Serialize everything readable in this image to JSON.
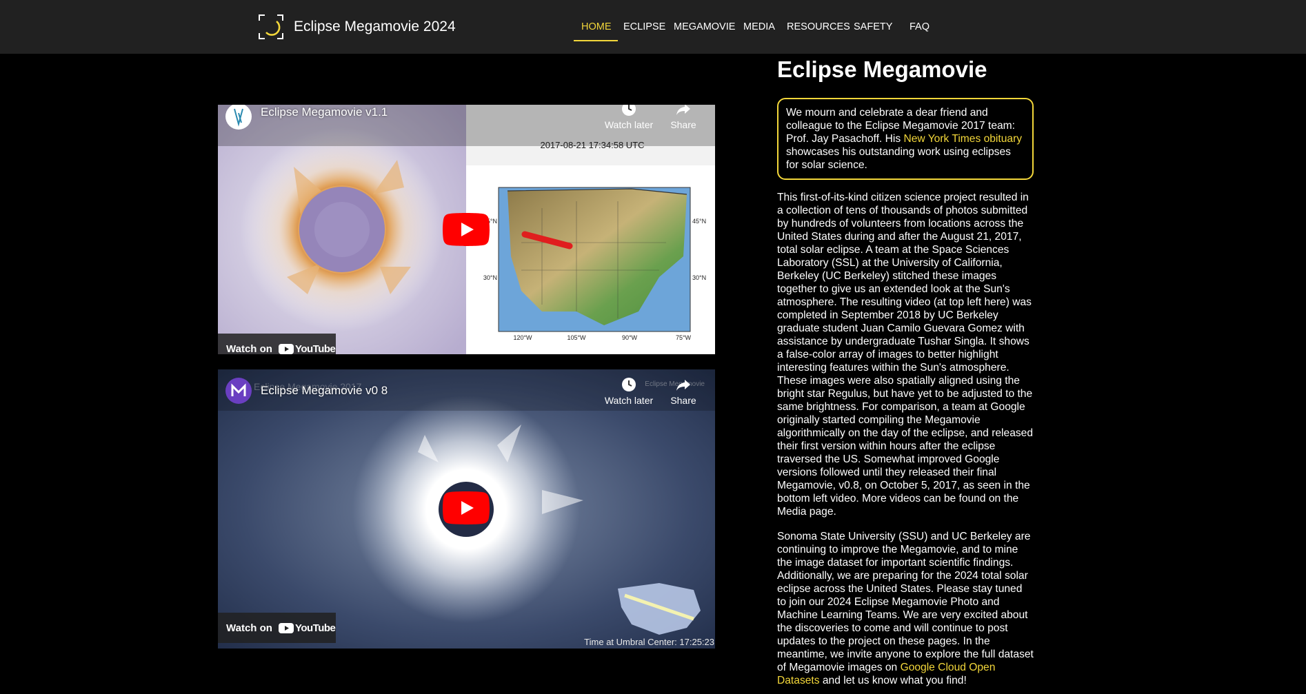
{
  "header": {
    "site_title": "Eclipse Megamovie 2024",
    "nav": [
      {
        "label": "HOME",
        "active": true
      },
      {
        "label": "ECLIPSE"
      },
      {
        "label": "MEGAMOVIE"
      },
      {
        "label": "MEDIA"
      },
      {
        "label": "RESOURCES"
      },
      {
        "label": "SAFETY"
      },
      {
        "label": "FAQ"
      }
    ]
  },
  "videos": [
    {
      "title": "Eclipse Megamovie v1.1",
      "watch_later": "Watch later",
      "share": "Share",
      "watch_on": "Watch on",
      "youtube": "YouTube",
      "timestamp": "2017-08-21 17:34:58 UTC",
      "map_ticks": {
        "lat_left_top": "45°N",
        "lat_left_bottom": "30°N",
        "lat_right_top": "45°N",
        "lat_right_bottom": "30°N",
        "lon": [
          "120°W",
          "105°W",
          "90°W",
          "75°W"
        ]
      }
    },
    {
      "title": "Eclipse Megamovie v0 8",
      "ghost_title": "Eclipse Megamovie 2017",
      "watch_later": "Watch later",
      "share": "Share",
      "watch_on": "Watch on",
      "youtube": "YouTube",
      "corner_mark": "Eclipse Megamovie",
      "time_label": "Time at Umbral Center: 17:25:23"
    }
  ],
  "side": {
    "title": "Eclipse Megamovie",
    "notice": {
      "text_before": "We mourn and celebrate a dear friend and colleague to the Eclipse Megamovie 2017 team: Prof. Jay Pasachoff. His ",
      "link": "New York Times obituary",
      "text_after": " showcases his outstanding work using eclipses for solar science."
    },
    "para1": "This first-of-its-kind citizen science project resulted in a collection of tens of thousands of photos submitted by hundreds of volunteers from locations across the United States during and after the August 21, 2017, total solar eclipse. A team at the Space Sciences Laboratory (SSL) at the University of California, Berkeley (UC Berkeley) stitched these images together to give us an extended look at the Sun's atmosphere. The resulting video (at top left here) was completed in September 2018 by UC Berkeley graduate student Juan Camilo Guevara Gomez with assistance by undergraduate Tushar Singla. It shows a false-color array of images to better highlight interesting features within the Sun's atmosphere. These images were also spatially aligned using the bright star Regulus, but have yet to be adjusted to the same brightness. For comparison, a team at Google originally started compiling the Megamovie algorithmically on the day of the eclipse, and released their first version within hours after the eclipse traversed the US. Somewhat improved Google versions followed until they released their final Megamovie, v0.8, on October 5, 2017, as seen in the bottom left video. More videos can be found on the Media page.",
    "para2_before": "Sonoma State University (SSU) and UC Berkeley are continuing to improve the Megamovie, and to mine the image dataset for important scientific findings. Additionally, we are preparing for the 2024 total solar eclipse across the United States. Please stay tuned to join our 2024 Eclipse Megamovie Photo and Machine Learning Teams. We are very excited about the discoveries to come and will continue to post updates to the project on these pages. In the meantime, we invite anyone to explore the full dataset of Megamovie images on ",
    "para2_link": "Google Cloud Open Datasets",
    "para2_after": " and let us know what you find!"
  },
  "colors": {
    "accent": "#f3d73a",
    "header_bg": "#212121",
    "page_bg": "#000000",
    "youtube_red": "#ff0000"
  }
}
